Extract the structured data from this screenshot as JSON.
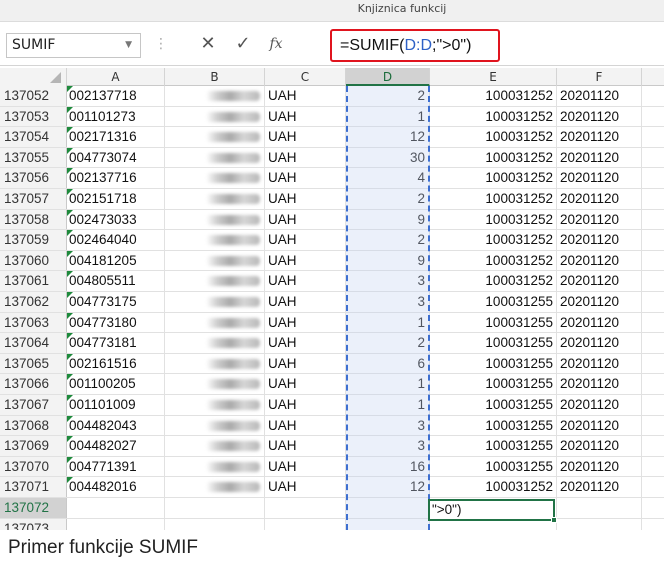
{
  "window": {
    "title": "Knjiznica funkcij"
  },
  "formula_bar": {
    "name_box": "SUMIF",
    "cancel_icon": "close-icon",
    "enter_icon": "check-icon",
    "fx_label": "fx",
    "formula_prefix": "=SUMIF(",
    "formula_ref": "D:D",
    "formula_suffix": ";\">0\")",
    "highlight_color": "#e0141e"
  },
  "columns": [
    "A",
    "B",
    "C",
    "D",
    "E",
    "F"
  ],
  "selected_column": "D",
  "rows": [
    {
      "n": "137052",
      "a": "002137718",
      "c": "UAH",
      "d": "2",
      "e": "100031252",
      "f": "20201120"
    },
    {
      "n": "137053",
      "a": "001101273",
      "c": "UAH",
      "d": "1",
      "e": "100031252",
      "f": "20201120"
    },
    {
      "n": "137054",
      "a": "002171316",
      "c": "UAH",
      "d": "12",
      "e": "100031252",
      "f": "20201120"
    },
    {
      "n": "137055",
      "a": "004773074",
      "c": "UAH",
      "d": "30",
      "e": "100031252",
      "f": "20201120"
    },
    {
      "n": "137056",
      "a": "002137716",
      "c": "UAH",
      "d": "4",
      "e": "100031252",
      "f": "20201120"
    },
    {
      "n": "137057",
      "a": "002151718",
      "c": "UAH",
      "d": "2",
      "e": "100031252",
      "f": "20201120"
    },
    {
      "n": "137058",
      "a": "002473033",
      "c": "UAH",
      "d": "9",
      "e": "100031252",
      "f": "20201120"
    },
    {
      "n": "137059",
      "a": "002464040",
      "c": "UAH",
      "d": "2",
      "e": "100031252",
      "f": "20201120"
    },
    {
      "n": "137060",
      "a": "004181205",
      "c": "UAH",
      "d": "9",
      "e": "100031252",
      "f": "20201120"
    },
    {
      "n": "137061",
      "a": "004805511",
      "c": "UAH",
      "d": "3",
      "e": "100031252",
      "f": "20201120"
    },
    {
      "n": "137062",
      "a": "004773175",
      "c": "UAH",
      "d": "3",
      "e": "100031255",
      "f": "20201120"
    },
    {
      "n": "137063",
      "a": "004773180",
      "c": "UAH",
      "d": "1",
      "e": "100031255",
      "f": "20201120"
    },
    {
      "n": "137064",
      "a": "004773181",
      "c": "UAH",
      "d": "2",
      "e": "100031255",
      "f": "20201120"
    },
    {
      "n": "137065",
      "a": "002161516",
      "c": "UAH",
      "d": "6",
      "e": "100031255",
      "f": "20201120"
    },
    {
      "n": "137066",
      "a": "001100205",
      "c": "UAH",
      "d": "1",
      "e": "100031255",
      "f": "20201120"
    },
    {
      "n": "137067",
      "a": "001101009",
      "c": "UAH",
      "d": "1",
      "e": "100031255",
      "f": "20201120"
    },
    {
      "n": "137068",
      "a": "004482043",
      "c": "UAH",
      "d": "3",
      "e": "100031255",
      "f": "20201120"
    },
    {
      "n": "137069",
      "a": "004482027",
      "c": "UAH",
      "d": "3",
      "e": "100031255",
      "f": "20201120"
    },
    {
      "n": "137070",
      "a": "004771391",
      "c": "UAH",
      "d": "16",
      "e": "100031255",
      "f": "20201120"
    },
    {
      "n": "137071",
      "a": "004482016",
      "c": "UAH",
      "d": "12",
      "e": "100031252",
      "f": "20201120"
    },
    {
      "n": "137072",
      "a": "",
      "c": "",
      "d": "",
      "e": "",
      "f": ""
    },
    {
      "n": "137073",
      "a": "",
      "c": "",
      "d": "",
      "e": "",
      "f": ""
    }
  ],
  "active_cell": {
    "row": "137072",
    "column": "E",
    "content": "\">0\")"
  },
  "caption": "Primer funkcije SUMIF"
}
